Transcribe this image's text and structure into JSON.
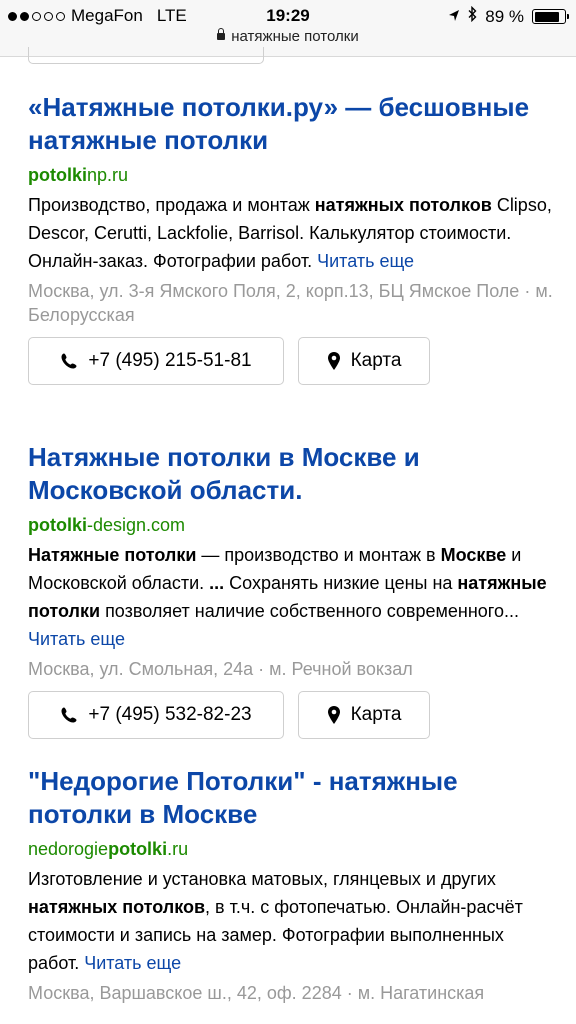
{
  "status_bar": {
    "carrier": "MegaFon",
    "network": "LTE",
    "time": "19:29",
    "battery": "89 %",
    "battery_level": 0.89,
    "signal_bars": 2,
    "icons": [
      "location-arrow-icon",
      "bluetooth-icon",
      "battery-icon"
    ]
  },
  "url_bar": {
    "text": "натяжные потолки"
  },
  "results": [
    {
      "title_parts": [
        {
          "t": "«",
          "b": false
        },
        {
          "t": "Натяжные потолки",
          "b": true
        },
        {
          "t": ".ру» — бесшовные ",
          "b": false
        },
        {
          "t": "натяжные потолки",
          "b": true
        }
      ],
      "url_parts": [
        {
          "t": "potolki",
          "b": true
        },
        {
          "t": "np.ru",
          "b": false
        }
      ],
      "snippet_parts": [
        {
          "t": "Производство, продажа и монтаж ",
          "b": false
        },
        {
          "t": "натяжных потолков",
          "b": true
        },
        {
          "t": " Clipso, Descor, Cerutti, Lackfolie, Barrisol. Калькулятор стоимости. Онлайн-заказ. Фотографии работ. ",
          "b": false
        }
      ],
      "read_more": "Читать еще",
      "address": "Москва, ул. 3-я Ямского Поля, 2, корп.13, БЦ Ямское Поле · м. Белорусская",
      "phone": "+7 (495) 215-51-81",
      "map": "Карта"
    },
    {
      "title_parts": [
        {
          "t": "Натяжные потолки",
          "b": true
        },
        {
          "t": " в ",
          "b": false
        },
        {
          "t": "Москве",
          "b": true
        },
        {
          "t": " и Московской области.",
          "b": false
        }
      ],
      "url_parts": [
        {
          "t": "potolki",
          "b": true
        },
        {
          "t": "-design.com",
          "b": false
        }
      ],
      "snippet_parts": [
        {
          "t": "Натяжные потолки",
          "b": true
        },
        {
          "t": " — производство и монтаж в ",
          "b": false
        },
        {
          "t": "Москве",
          "b": true
        },
        {
          "t": " и Московской области. ",
          "b": false
        },
        {
          "t": "...",
          "b": true
        },
        {
          "t": " Сохранять низкие цены на ",
          "b": false
        },
        {
          "t": "натяжные потолки",
          "b": true
        },
        {
          "t": " позволяет наличие собственного современного... ",
          "b": false
        }
      ],
      "read_more": "Читать еще",
      "address": "Москва, ул. Смольная, 24а · м. Речной вокзал",
      "phone": "+7 (495) 532-82-23",
      "map": "Карта"
    },
    {
      "title_parts": [
        {
          "t": "\"Недорогие ",
          "b": false
        },
        {
          "t": "Потолки",
          "b": true
        },
        {
          "t": "\" - ",
          "b": false
        },
        {
          "t": "натяжные потолки",
          "b": true
        },
        {
          "t": " в ",
          "b": false
        },
        {
          "t": "Москве",
          "b": true
        }
      ],
      "url_parts": [
        {
          "t": "nedorogie",
          "b": false
        },
        {
          "t": "potolki",
          "b": true
        },
        {
          "t": ".ru",
          "b": false
        }
      ],
      "snippet_parts": [
        {
          "t": "Изготовление и установка матовых, глянцевых и других ",
          "b": false
        },
        {
          "t": "натяжных потолков",
          "b": true
        },
        {
          "t": ", в т.ч. с фотопечатью. Онлайн-расчёт стоимости и запись на замер. Фотографии выполненных работ. ",
          "b": false
        }
      ],
      "read_more": "Читать еще",
      "address": "Москва, Варшавское ш., 42, оф. 2284 · м. Нагатинская"
    }
  ]
}
